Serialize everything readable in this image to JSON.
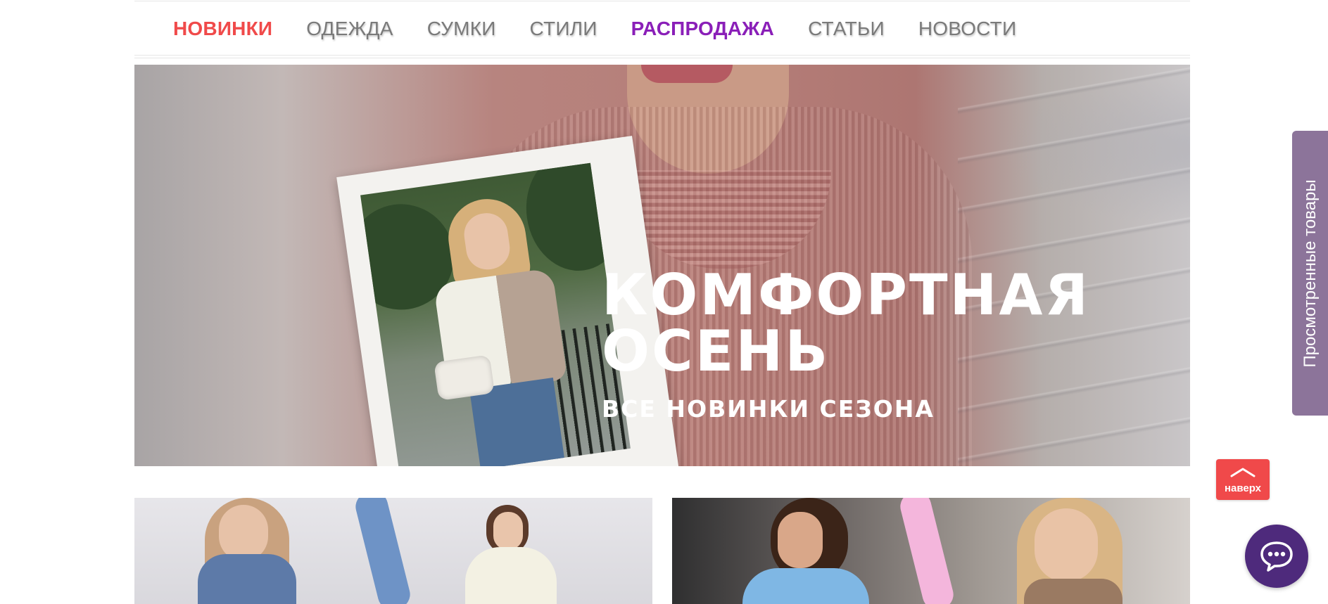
{
  "nav": {
    "items": [
      {
        "label": "НОВИНКИ"
      },
      {
        "label": "ОДЕЖДА"
      },
      {
        "label": "СУМКИ"
      },
      {
        "label": "СТИЛИ"
      },
      {
        "label": "РАСПРОДАЖА"
      },
      {
        "label": "СТАТЬИ"
      },
      {
        "label": "НОВОСТИ"
      }
    ],
    "colors": {
      "new": "#f04a4a",
      "sale": "#8a1fb8",
      "default": "#7a7a7a"
    }
  },
  "hero": {
    "title_line1": "КОМФОРТНАЯ",
    "title_line2": "ОСЕНЬ",
    "subtitle": "ВСЕ НОВИНКИ СЕЗОНА"
  },
  "side_tab": {
    "label": "Просмотренные товары",
    "color": "#8c749a"
  },
  "back_to_top": {
    "label": "наверх",
    "icon": "chevron-up-icon",
    "color": "#f0494a"
  },
  "chat": {
    "icon": "chat-icon",
    "color": "#4e2a7c"
  }
}
